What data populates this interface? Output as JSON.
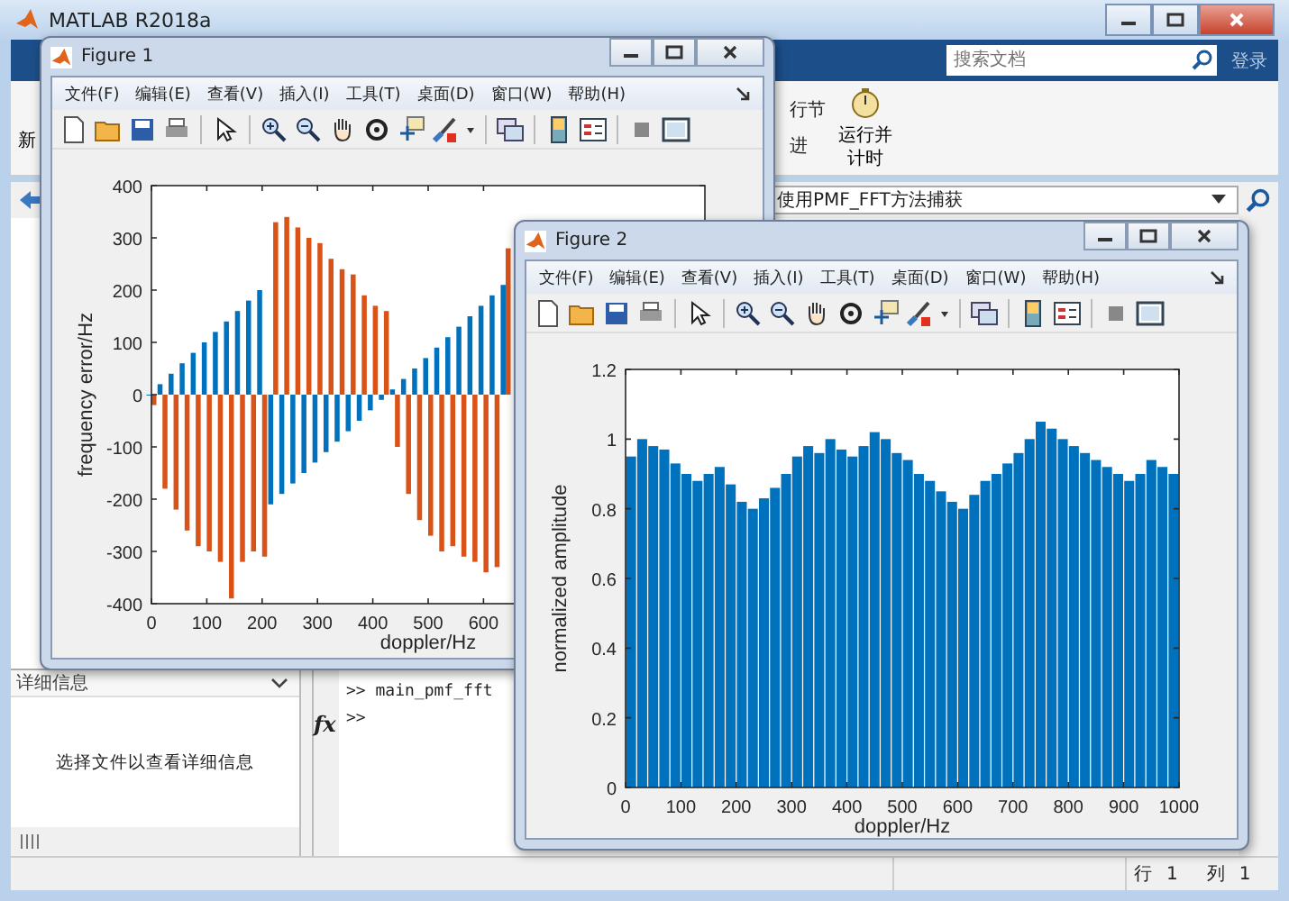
{
  "window": {
    "title": "MATLAB R2018a"
  },
  "toolstrip": {
    "search": {
      "placeholder": "搜索文档"
    },
    "sign_in": "登录",
    "left_button": "新",
    "right_items": [
      "行节",
      "进"
    ],
    "run_time_button": "运行并计时"
  },
  "address_bar": {
    "path": "使用PMF_FFT方法捕获"
  },
  "details_panel": {
    "title": "详细信息",
    "message": "选择文件以查看详细信息"
  },
  "command_window": {
    "lines": [
      ">> main_pmf_fft"
    ],
    "prompt": ">>",
    "fx_label": "fx"
  },
  "status_bar": {
    "row_label": "行",
    "row": "1",
    "col_label": "列",
    "col": "1"
  },
  "figures": [
    {
      "title": "Figure 1",
      "menu": [
        "文件(F)",
        "编辑(E)",
        "查看(V)",
        "插入(I)",
        "工具(T)",
        "桌面(D)",
        "窗口(W)",
        "帮助(H)"
      ],
      "chart_data": {
        "type": "bar",
        "xlabel": "doppler/Hz",
        "ylabel": "frequency error/Hz",
        "xlim": [
          0,
          1000
        ],
        "ylim": [
          -400,
          400
        ],
        "xticks": [
          0,
          100,
          200,
          300,
          400,
          500,
          600
        ],
        "yticks": [
          -400,
          -300,
          -200,
          -100,
          0,
          100,
          200,
          300,
          400
        ],
        "x": [
          0,
          20,
          40,
          60,
          80,
          100,
          120,
          140,
          160,
          180,
          200,
          220,
          240,
          260,
          280,
          300,
          320,
          340,
          360,
          380,
          400,
          420,
          440,
          460,
          480,
          500,
          520,
          540,
          560,
          580,
          600,
          620,
          640
        ],
        "series": [
          {
            "color": "#0072bd",
            "values": [
              0,
              20,
              40,
              60,
              80,
              100,
              120,
              140,
              160,
              180,
              200,
              -210,
              -190,
              -170,
              -150,
              -130,
              -110,
              -90,
              -70,
              -50,
              -30,
              -10,
              10,
              30,
              50,
              70,
              90,
              110,
              130,
              150,
              170,
              190,
              210
            ]
          },
          {
            "color": "#d95319",
            "values": [
              -20,
              -180,
              -220,
              -260,
              -290,
              -300,
              -320,
              -390,
              -320,
              -300,
              -310,
              330,
              340,
              320,
              300,
              290,
              260,
              240,
              230,
              190,
              170,
              160,
              -100,
              -190,
              -240,
              -270,
              -300,
              -290,
              -310,
              -320,
              -340,
              -330,
              280
            ]
          }
        ]
      }
    },
    {
      "title": "Figure 2",
      "menu": [
        "文件(F)",
        "编辑(E)",
        "查看(V)",
        "插入(I)",
        "工具(T)",
        "桌面(D)",
        "窗口(W)",
        "帮助(H)"
      ],
      "chart_data": {
        "type": "bar",
        "xlabel": "doppler/Hz",
        "ylabel": "normalized amplitude",
        "xlim": [
          0,
          1000
        ],
        "ylim": [
          0,
          1.2
        ],
        "xticks": [
          0,
          100,
          200,
          300,
          400,
          500,
          600,
          700,
          800,
          900,
          1000
        ],
        "yticks": [
          0,
          0.2,
          0.4,
          0.6,
          0.8,
          1,
          1.2
        ],
        "x": [
          10,
          30,
          50,
          70,
          90,
          110,
          130,
          150,
          170,
          190,
          210,
          230,
          250,
          270,
          290,
          310,
          330,
          350,
          370,
          390,
          410,
          430,
          450,
          470,
          490,
          510,
          530,
          550,
          570,
          590,
          610,
          630,
          650,
          670,
          690,
          710,
          730,
          750,
          770,
          790,
          810,
          830,
          850,
          870,
          890,
          910,
          930,
          950,
          970,
          990
        ],
        "series": [
          {
            "color": "#0072bd",
            "values": [
              0.95,
              1.0,
              0.98,
              0.97,
              0.93,
              0.9,
              0.88,
              0.9,
              0.92,
              0.87,
              0.82,
              0.8,
              0.83,
              0.86,
              0.9,
              0.95,
              0.98,
              0.96,
              1.0,
              0.97,
              0.95,
              0.98,
              1.02,
              1.0,
              0.96,
              0.94,
              0.9,
              0.88,
              0.85,
              0.82,
              0.8,
              0.84,
              0.88,
              0.9,
              0.93,
              0.96,
              1.0,
              1.05,
              1.03,
              1.0,
              0.98,
              0.96,
              0.94,
              0.92,
              0.9,
              0.88,
              0.9,
              0.94,
              0.92,
              0.9
            ]
          }
        ]
      }
    }
  ]
}
